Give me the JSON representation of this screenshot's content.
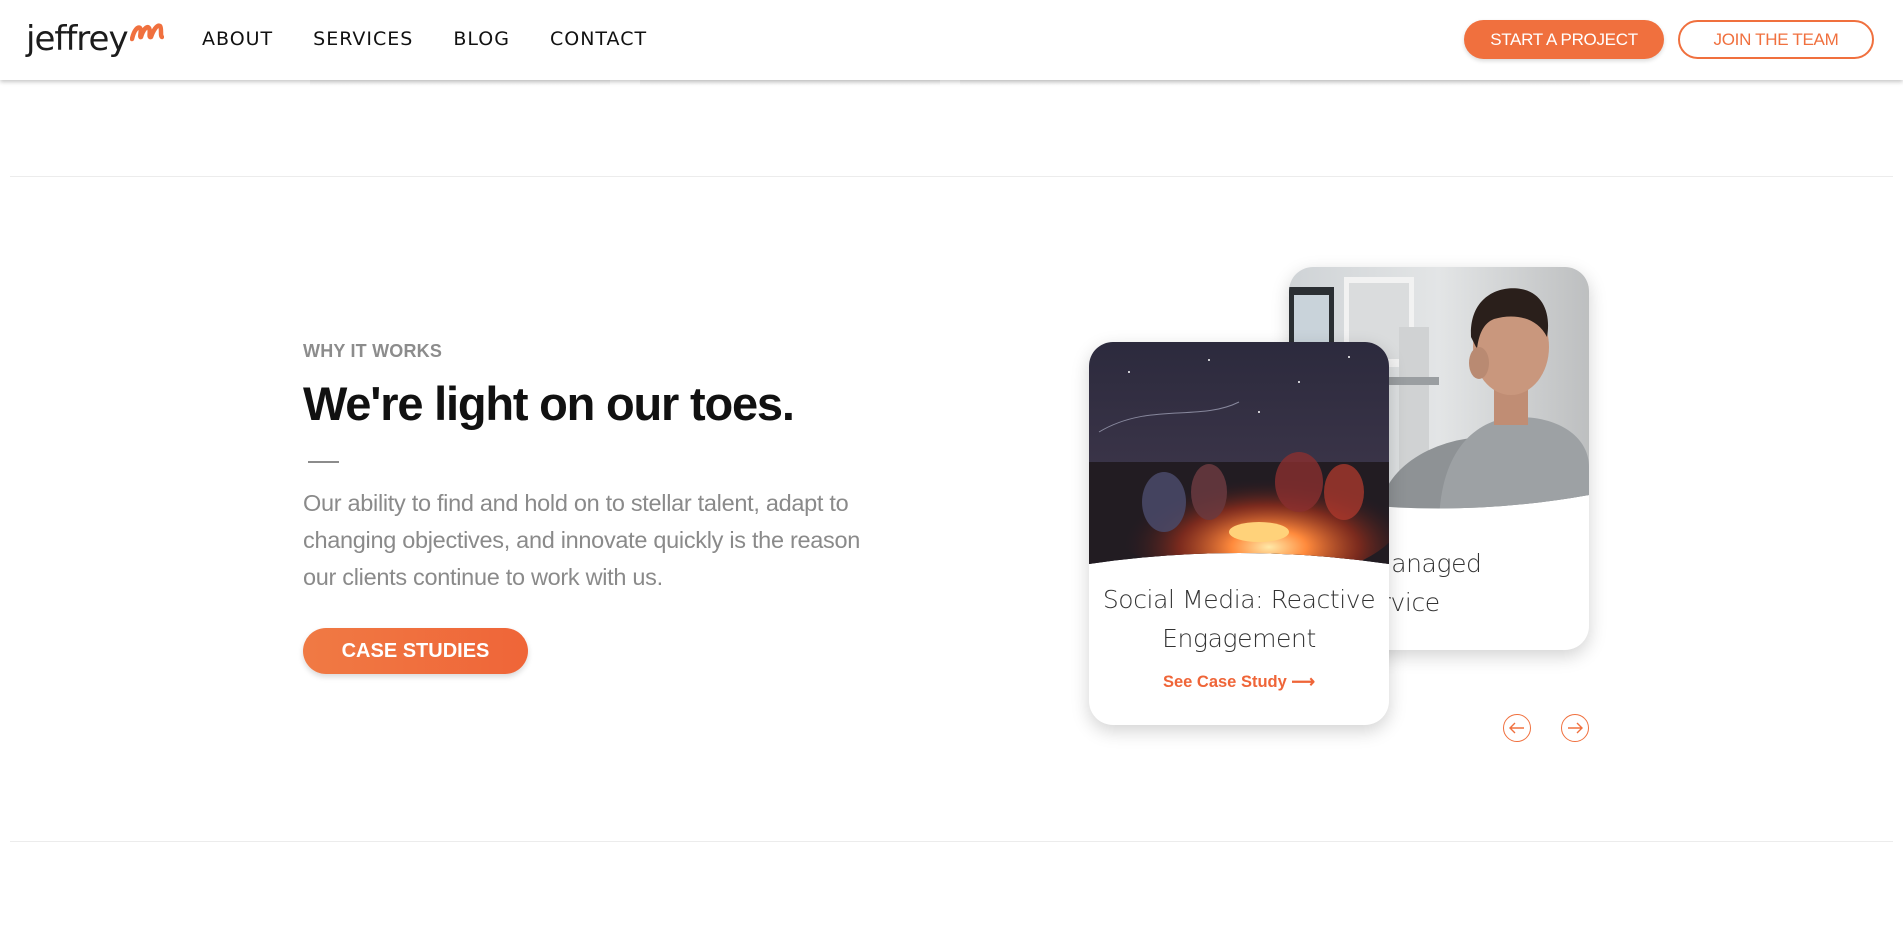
{
  "brand": {
    "name": "jeffrey",
    "mark_icon": "m-swoosh-logo-mark",
    "accent_color": "#f0703e"
  },
  "nav": {
    "items": [
      {
        "label": "ABOUT"
      },
      {
        "label": "SERVICES"
      },
      {
        "label": "BLOG"
      },
      {
        "label": "CONTACT"
      }
    ]
  },
  "header": {
    "start_project_label": "START A PROJECT",
    "join_team_label": "JOIN THE TEAM"
  },
  "section": {
    "eyebrow": "WHY IT WORKS",
    "headline": "We're light on our toes.",
    "body": "Our ability to find and hold on to stellar talent, adapt to changing objectives, and innovate quickly is the reason our clients continue to work with us.",
    "cta_label": "CASE STUDIES"
  },
  "carousel": {
    "cards": [
      {
        "title_line1": "Social Media: Reactive",
        "title_line2": "Engagement",
        "link_label": "See Case Study",
        "link_icon": "arrow-right-icon",
        "image": "campfire-at-night-photo"
      },
      {
        "title_line1": "ting: Managed",
        "title_line2": "Service",
        "image": "man-at-computer-office-photo"
      }
    ],
    "prev_icon": "arrow-left-circle-icon",
    "next_icon": "arrow-right-circle-icon"
  }
}
